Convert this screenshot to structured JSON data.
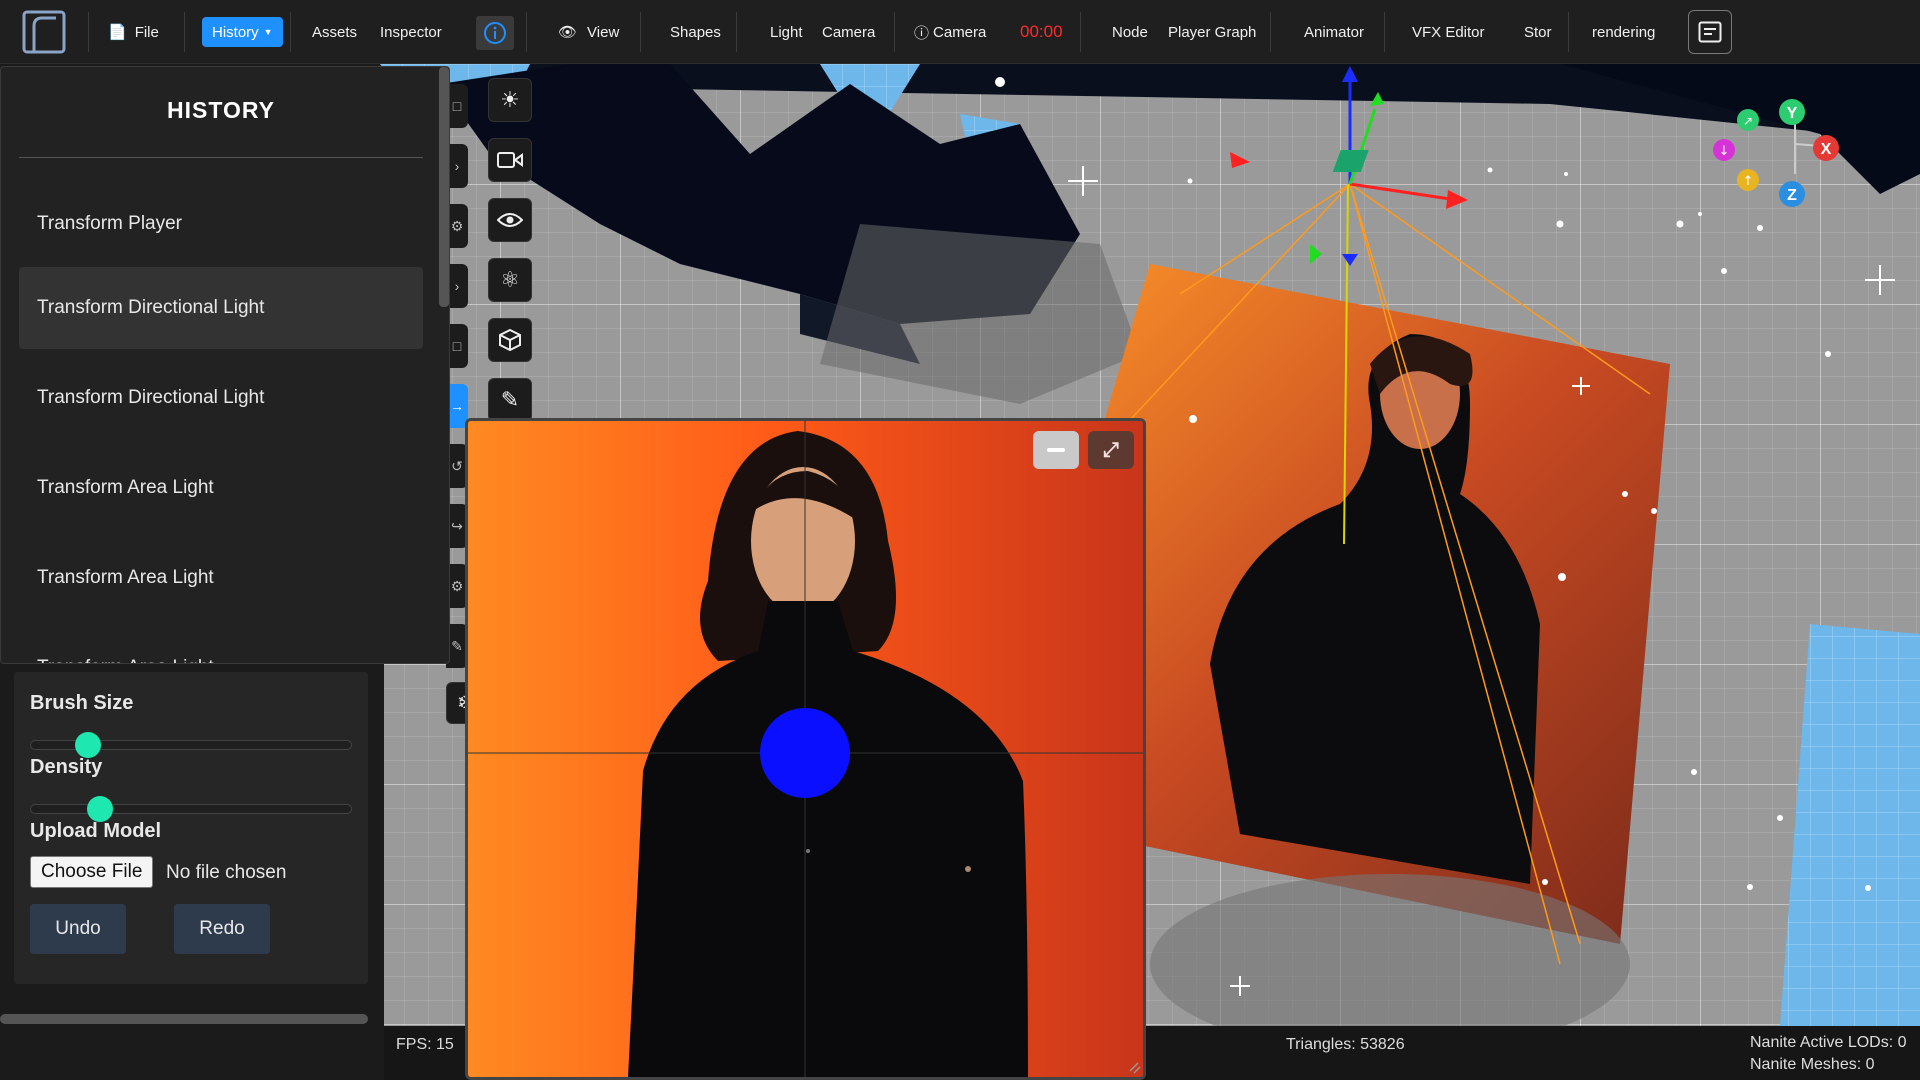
{
  "toolbar": {
    "logo": "app-logo",
    "file": "File",
    "history": "History",
    "assets": "Assets",
    "inspector": "Inspector",
    "view": "View",
    "shapes": "Shapes",
    "light": "Light",
    "camera": "Camera",
    "camera_info": "Camera",
    "timer": "00:00",
    "node": "Node",
    "player_graph": "Player Graph",
    "animator": "Animator",
    "vfx_editor": "VFX Editor",
    "store": "Stor",
    "rendering": "rendering"
  },
  "history_panel": {
    "title": "HISTORY",
    "items": [
      {
        "label": "Transform Player",
        "active": false
      },
      {
        "label": "Transform Directional Light",
        "active": true
      },
      {
        "label": "Transform Directional Light",
        "active": false
      },
      {
        "label": "Transform Area Light",
        "active": false
      },
      {
        "label": "Transform Area Light",
        "active": false
      },
      {
        "label": "Transform Area Light",
        "active": false
      }
    ]
  },
  "tools": [
    "sun-icon",
    "video-camera-icon",
    "eye-icon",
    "atom-icon",
    "cube-icon",
    "pen-tool-icon",
    "snowflake-icon"
  ],
  "settings": {
    "brush_size_label": "Brush Size",
    "brush_size_value": 0.15,
    "density_label": "Density",
    "density_value": 0.19,
    "upload_label": "Upload Model",
    "choose_file": "Choose File",
    "no_file": "No file chosen",
    "undo": "Undo",
    "redo": "Redo"
  },
  "gizmo": {
    "x": "X",
    "y": "Y",
    "z": "Z"
  },
  "status": {
    "fps": "FPS: 15",
    "triangles": "Triangles: 53826",
    "nanite_lods": "Nanite Active LODs: 0",
    "nanite_meshes": "Nanite Meshes: 0"
  },
  "colors": {
    "accent": "#1e90ff",
    "slider": "#1ee8b0",
    "timer": "#ff2a2a",
    "gizmo_x": "#e53935",
    "gizmo_y": "#2ecc71",
    "gizmo_z": "#2a8fe0"
  }
}
